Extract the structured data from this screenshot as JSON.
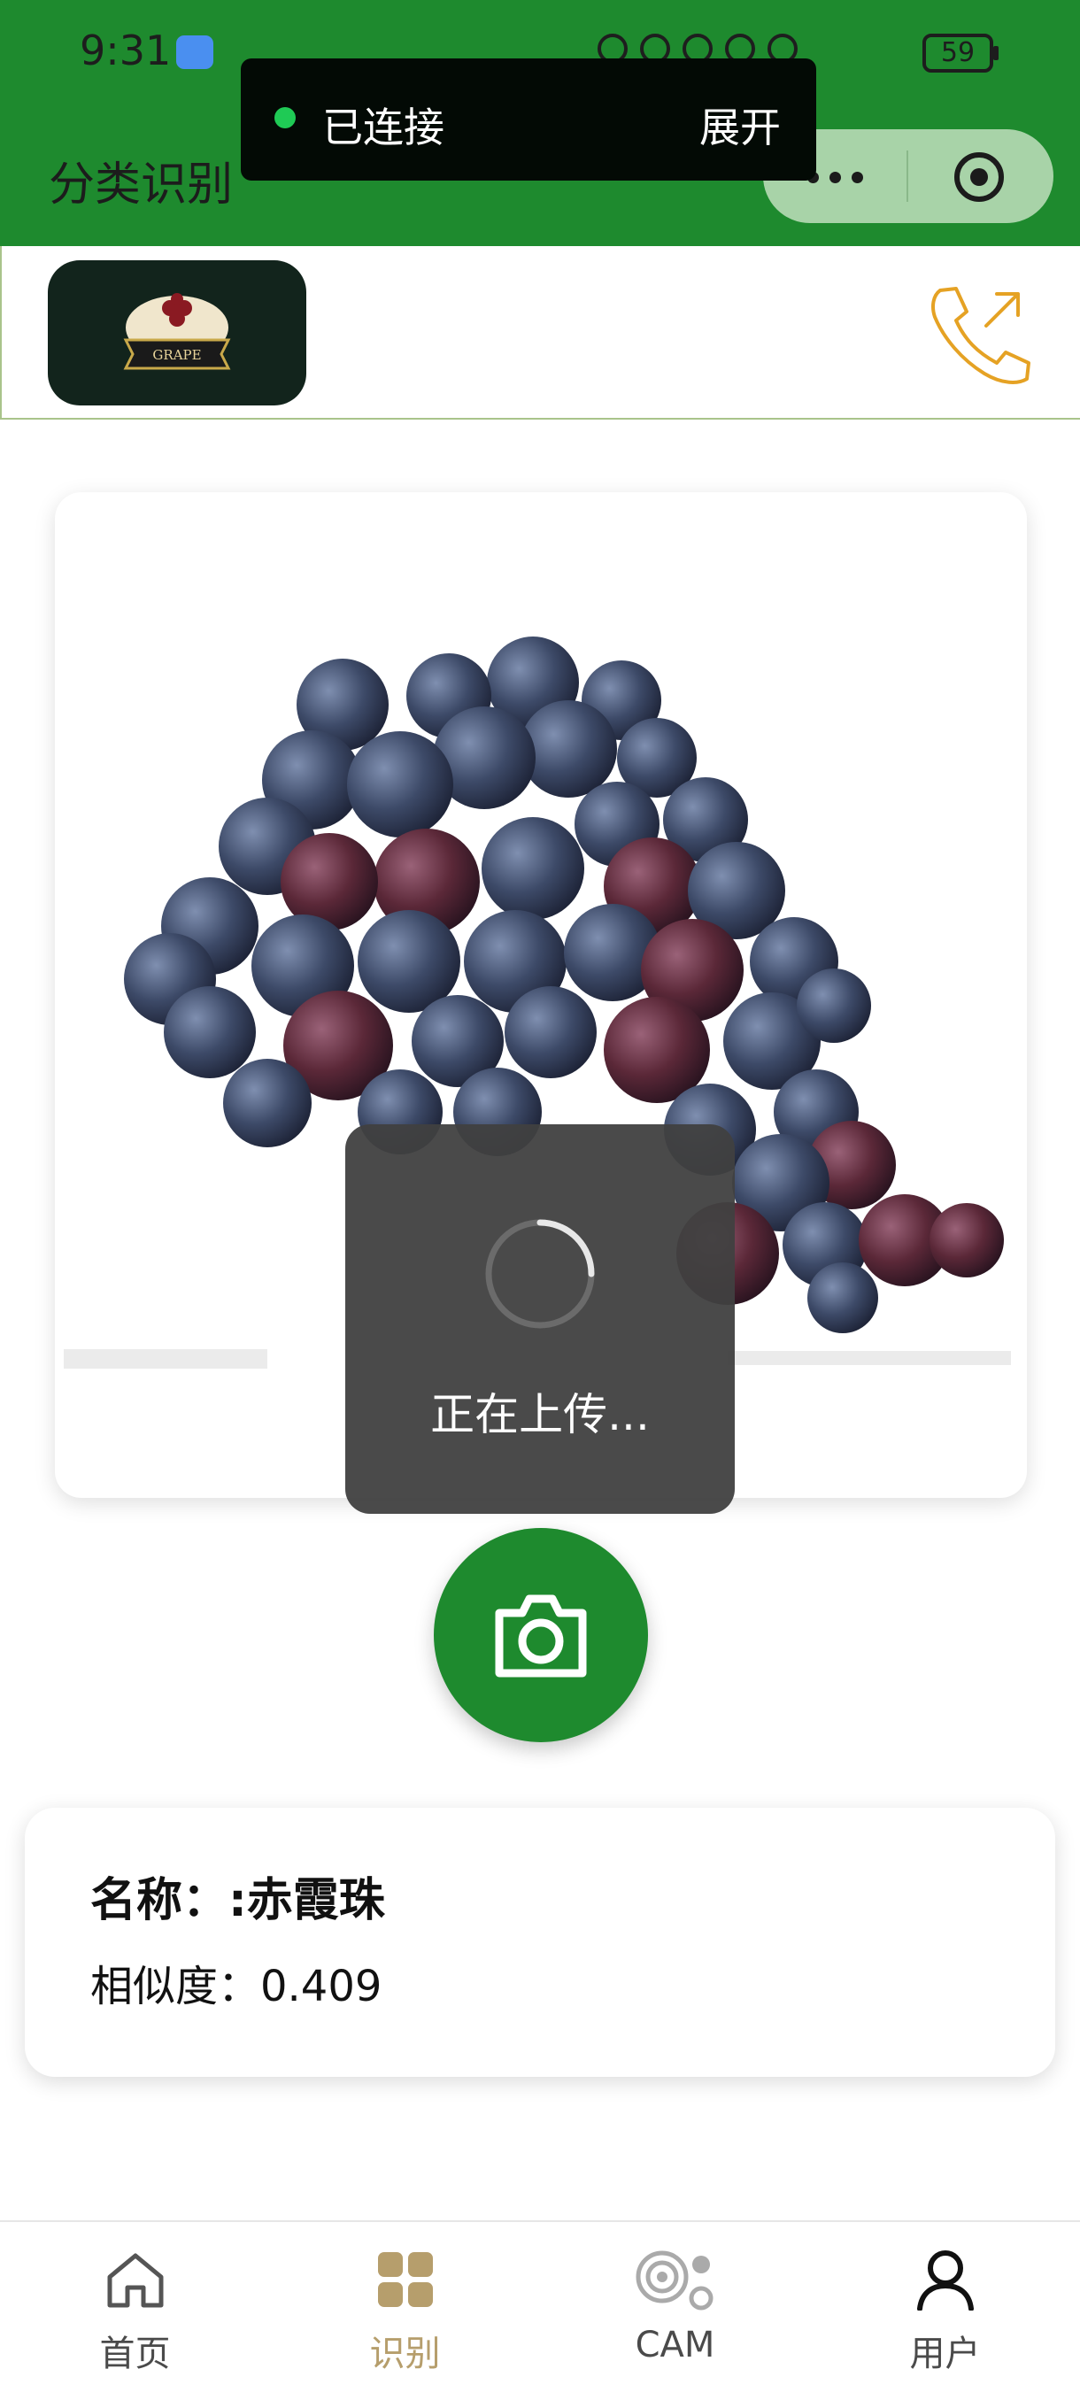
{
  "status_bar": {
    "time": "9:31",
    "battery": "59"
  },
  "toast": {
    "status": "已连接",
    "expand": "展开"
  },
  "header": {
    "title": "分类识别"
  },
  "brand": {
    "logo_text": "GRAPE"
  },
  "loading": {
    "text": "正在上传..."
  },
  "result": {
    "name": "名称：:赤霞珠",
    "similarity": "相似度：0.409"
  },
  "tabs": [
    {
      "label": "首页",
      "icon": "home-icon",
      "active": false
    },
    {
      "label": "识别",
      "icon": "grid-icon",
      "active": true
    },
    {
      "label": "CAM",
      "icon": "cam-icon",
      "active": false
    },
    {
      "label": "用户",
      "icon": "user-icon",
      "active": false
    }
  ],
  "colors": {
    "primary": "#1e8a2e",
    "active_tab": "#b69e6c",
    "phone_icon": "#e5a224"
  }
}
